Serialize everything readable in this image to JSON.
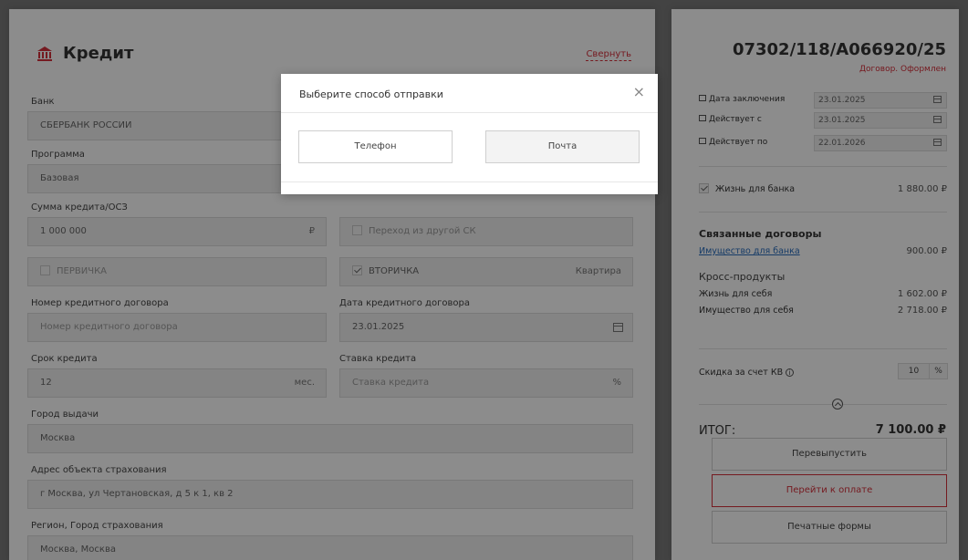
{
  "credit": {
    "title": "Кредит",
    "collapse": "Свернуть",
    "bank_label": "Банк",
    "bank_value": "СБЕРБАНК РОССИИ",
    "program_label": "Программа",
    "program_value": "Базовая",
    "sum_label": "Сумма кредита/ОСЗ",
    "sum_value": "1 000 000",
    "sum_unit": "₽",
    "transfer_label": "Переход из другой СК",
    "primary_label": "ПЕРВИЧКА",
    "secondary_label": "ВТОРИЧКА",
    "property_type": "Квартира",
    "contract_no_label": "Номер кредитного договора",
    "contract_no_placeholder": "Номер кредитного договора",
    "contract_date_label": "Дата кредитного договора",
    "contract_date_value": "23.01.2025",
    "term_label": "Срок кредита",
    "term_value": "12",
    "term_unit": "мес.",
    "rate_label": "Ставка кредита",
    "rate_placeholder": "Ставка кредита",
    "rate_unit": "%",
    "city_label": "Город выдачи",
    "city_value": "Москва",
    "address_label": "Адрес объекта страхования",
    "address_value": "г Москва, ул Чертановская, д 5 к 1, кв 2",
    "region_label": "Регион, Город страхования",
    "region_value": "Москва, Москва"
  },
  "contract": {
    "number": "07302/118/A066920/25",
    "status": "Договор. Оформлен",
    "dates": [
      {
        "label": "Дата заключения",
        "value": "23.01.2025"
      },
      {
        "label": "Действует с",
        "value": "23.01.2025"
      },
      {
        "label": "Действует по",
        "value": "22.01.2026"
      }
    ],
    "life_bank_label": "Жизнь для банка",
    "life_bank_value": "1 880.00 ₽",
    "linked_title": "Связанные договоры",
    "linked_item_label": "Имущество для банка",
    "linked_item_value": "900.00 ₽",
    "cross_title": "Кросс-продукты",
    "cross_items": [
      {
        "label": "Жизнь для себя",
        "value": "1 602.00 ₽"
      },
      {
        "label": "Имущество для себя",
        "value": "2 718.00 ₽"
      }
    ],
    "discount_label": "Скидка за счет КВ",
    "discount_value": "10",
    "discount_unit": "%",
    "total_label": "ИТОГ:",
    "total_value": "7 100.00 ₽",
    "reissue_button": "Перевыпустить",
    "pay_button": "Перейти к оплате",
    "print_button": "Печатные формы"
  },
  "modal": {
    "title": "Выберите способ отправки",
    "close": "×",
    "phone_button": "Телефон",
    "mail_button": "Почта"
  },
  "colors": {
    "accent": "#d6303b",
    "link": "#2a6ebd"
  }
}
